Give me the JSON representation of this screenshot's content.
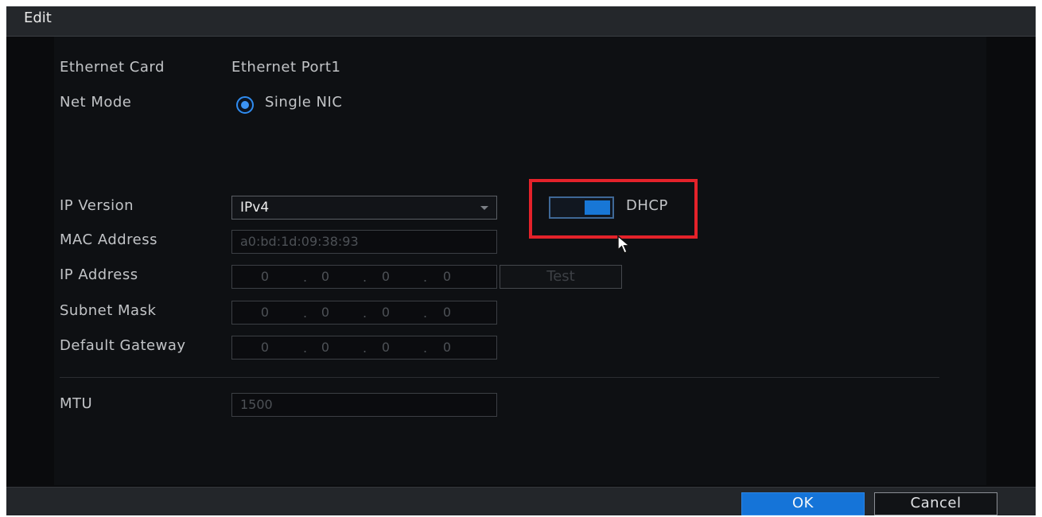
{
  "dialog": {
    "title": "Edit"
  },
  "form": {
    "ethernet_card_label": "Ethernet Card",
    "ethernet_card_value": "Ethernet Port1",
    "net_mode_label": "Net Mode",
    "net_mode_option": "Single NIC",
    "ip_version_label": "IP Version",
    "ip_version_value": "IPv4",
    "dhcp_label": "DHCP",
    "dhcp_enabled": true,
    "mac_address_label": "MAC Address",
    "mac_address_value": "a0:bd:1d:09:38:93",
    "ip_address_label": "IP Address",
    "ip_address": [
      "0",
      "0",
      "0",
      "0"
    ],
    "test_button": "Test",
    "subnet_mask_label": "Subnet Mask",
    "subnet_mask": [
      "0",
      "0",
      "0",
      "0"
    ],
    "default_gateway_label": "Default Gateway",
    "default_gateway": [
      "0",
      "0",
      "0",
      "0"
    ],
    "mtu_label": "MTU",
    "mtu_value": "1500"
  },
  "footer": {
    "ok_label": "OK",
    "cancel_label": "Cancel"
  },
  "icons": {
    "radio": "radio-selected-icon",
    "toggle": "toggle-switch-icon",
    "cursor": "mouse-pointer-icon",
    "caret": "chevron-down-icon"
  },
  "colors": {
    "accent": "#1574d8",
    "highlight": "#e4222a",
    "background": "#0a0b0d"
  }
}
